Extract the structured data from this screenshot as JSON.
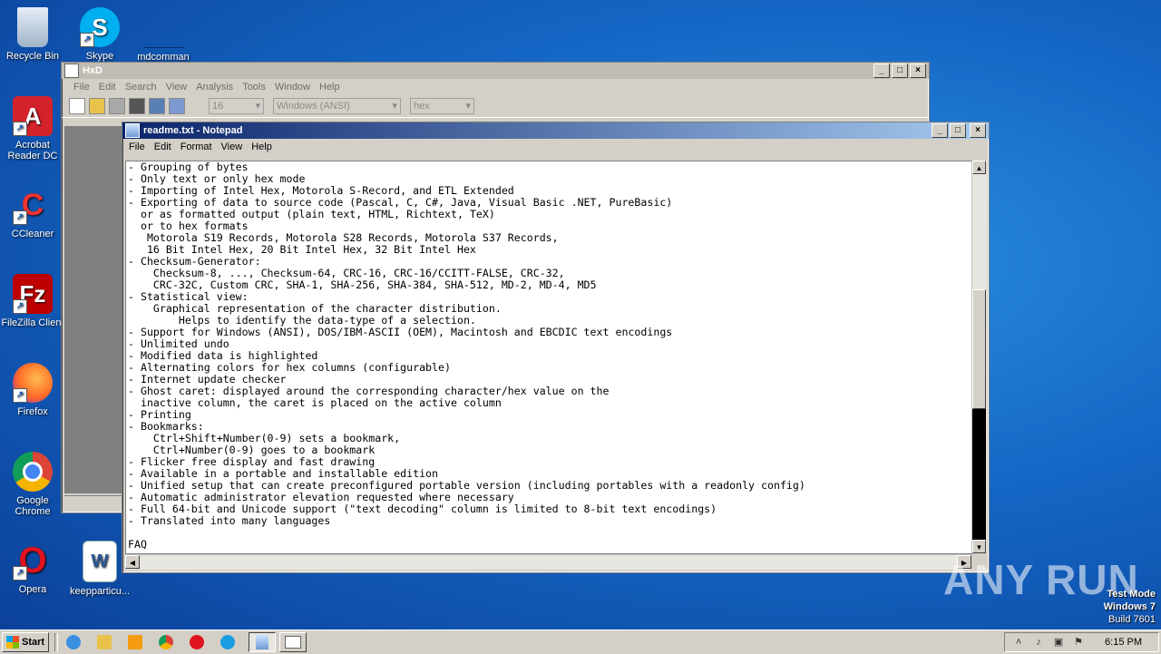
{
  "desktop": {
    "icons": [
      {
        "label": "Recycle Bin",
        "icon": "recycle-bin-icon"
      },
      {
        "label": "Skype",
        "icon": "skype-icon"
      },
      {
        "label": "mdcomman",
        "icon": "file-icon"
      },
      {
        "label": "Acrobat Reader DC",
        "icon": "acrobat-icon"
      },
      {
        "label": "CCleaner",
        "icon": "ccleaner-icon"
      },
      {
        "label": "FileZilla Client",
        "icon": "filezilla-icon"
      },
      {
        "label": "Firefox",
        "icon": "firefox-icon"
      },
      {
        "label": "Google Chrome",
        "icon": "chrome-icon"
      },
      {
        "label": "Opera",
        "icon": "opera-icon"
      },
      {
        "label": "keepparticu...",
        "icon": "word-doc-icon"
      }
    ]
  },
  "hxd": {
    "title": "HxD",
    "menu": [
      "File",
      "Edit",
      "Search",
      "View",
      "Analysis",
      "Tools",
      "Window",
      "Help"
    ],
    "toolbar": {
      "bytes_per_row": "16",
      "charset": "Windows (ANSI)",
      "offset_base": "hex"
    }
  },
  "notepad": {
    "title": "readme.txt - Notepad",
    "menu": [
      "File",
      "Edit",
      "Format",
      "View",
      "Help"
    ],
    "content": "- Grouping of bytes\n- Only text or only hex mode\n- Importing of Intel Hex, Motorola S-Record, and ETL Extended\n- Exporting of data to source code (Pascal, C, C#, Java, Visual Basic .NET, PureBasic)\n  or as formatted output (plain text, HTML, Richtext, TeX)\n  or to hex formats\n   Motorola S19 Records, Motorola S28 Records, Motorola S37 Records,\n   16 Bit Intel Hex, 20 Bit Intel Hex, 32 Bit Intel Hex\n- Checksum-Generator:\n    Checksum-8, ..., Checksum-64, CRC-16, CRC-16/CCITT-FALSE, CRC-32,\n    CRC-32C, Custom CRC, SHA-1, SHA-256, SHA-384, SHA-512, MD-2, MD-4, MD5\n- Statistical view:\n    Graphical representation of the character distribution.\n        Helps to identify the data-type of a selection.\n- Support for Windows (ANSI), DOS/IBM-ASCII (OEM), Macintosh and EBCDIC text encodings\n- Unlimited undo\n- Modified data is highlighted\n- Alternating colors for hex columns (configurable)\n- Internet update checker\n- Ghost caret: displayed around the corresponding character/hex value on the\n  inactive column, the caret is placed on the active column\n- Printing\n- Bookmarks:\n    Ctrl+Shift+Number(0-9) sets a bookmark,\n    Ctrl+Number(0-9) goes to a bookmark\n- Flicker free display and fast drawing\n- Available in a portable and installable edition\n- Unified setup that can create preconfigured portable version (including portables with a readonly config)\n- Automatic administrator elevation requested where necessary\n- Full 64-bit and Unicode support (\"text decoding\" column is limited to 8-bit text encodings)\n- Translated into many languages\n\nFAQ"
  },
  "taskbar": {
    "start_label": "Start",
    "clock": "6:15 PM"
  },
  "watermark": "ANY RUN",
  "test_mode": {
    "line1": "Test Mode",
    "line2": "Windows 7",
    "line3": "Build 7601"
  }
}
